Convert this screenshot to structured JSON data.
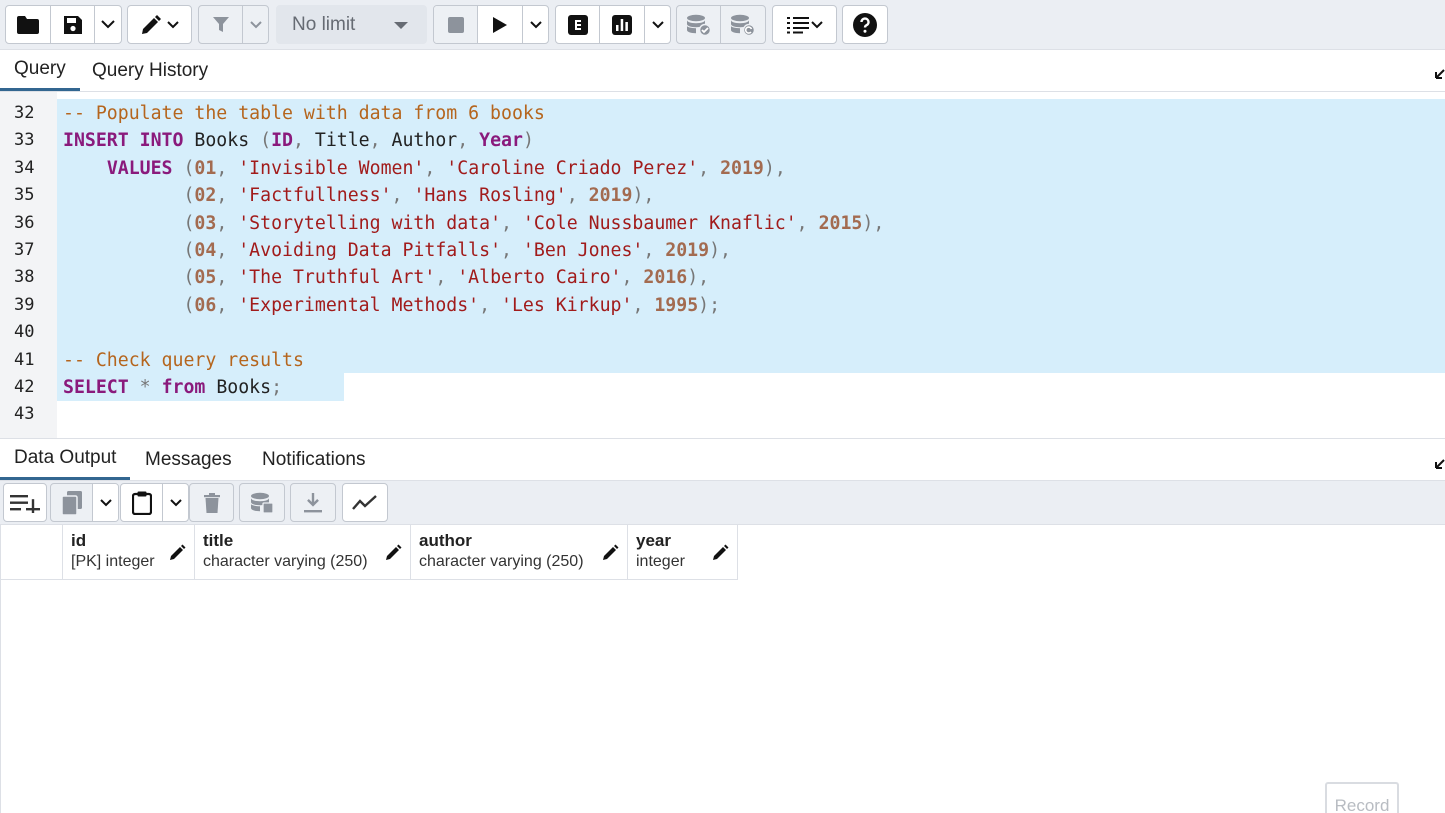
{
  "toolbar": {
    "row_limit": "No limit"
  },
  "query_tabs": [
    {
      "label": "Query",
      "active": true
    },
    {
      "label": "Query History",
      "active": false
    }
  ],
  "editor": {
    "lines": [
      {
        "num": "32",
        "tokens": [
          {
            "t": "cmt",
            "v": "-- Populate the table with data from 6 books"
          }
        ]
      },
      {
        "num": "33",
        "tokens": [
          {
            "t": "kw",
            "v": "INSERT INTO"
          },
          {
            "t": "",
            "v": " Books "
          },
          {
            "t": "pun",
            "v": "("
          },
          {
            "t": "kw",
            "v": "ID"
          },
          {
            "t": "pun",
            "v": ","
          },
          {
            "t": "",
            "v": " Title"
          },
          {
            "t": "pun",
            "v": ","
          },
          {
            "t": "",
            "v": " Author"
          },
          {
            "t": "pun",
            "v": ","
          },
          {
            "t": "",
            "v": " "
          },
          {
            "t": "kw",
            "v": "Year"
          },
          {
            "t": "pun",
            "v": ")"
          }
        ]
      },
      {
        "num": "34",
        "tokens": [
          {
            "t": "",
            "v": "    "
          },
          {
            "t": "kw",
            "v": "VALUES"
          },
          {
            "t": "",
            "v": " "
          },
          {
            "t": "pun",
            "v": "("
          },
          {
            "t": "num",
            "v": "01"
          },
          {
            "t": "pun",
            "v": ","
          },
          {
            "t": "",
            "v": " "
          },
          {
            "t": "str",
            "v": "'Invisible Women'"
          },
          {
            "t": "pun",
            "v": ","
          },
          {
            "t": "",
            "v": " "
          },
          {
            "t": "str",
            "v": "'Caroline Criado Perez'"
          },
          {
            "t": "pun",
            "v": ","
          },
          {
            "t": "",
            "v": " "
          },
          {
            "t": "num",
            "v": "2019"
          },
          {
            "t": "pun",
            "v": "),"
          }
        ]
      },
      {
        "num": "35",
        "tokens": [
          {
            "t": "",
            "v": "           "
          },
          {
            "t": "pun",
            "v": "("
          },
          {
            "t": "num",
            "v": "02"
          },
          {
            "t": "pun",
            "v": ","
          },
          {
            "t": "",
            "v": " "
          },
          {
            "t": "str",
            "v": "'Factfullness'"
          },
          {
            "t": "pun",
            "v": ","
          },
          {
            "t": "",
            "v": " "
          },
          {
            "t": "str",
            "v": "'Hans Rosling'"
          },
          {
            "t": "pun",
            "v": ","
          },
          {
            "t": "",
            "v": " "
          },
          {
            "t": "num",
            "v": "2019"
          },
          {
            "t": "pun",
            "v": "),"
          }
        ]
      },
      {
        "num": "36",
        "tokens": [
          {
            "t": "",
            "v": "           "
          },
          {
            "t": "pun",
            "v": "("
          },
          {
            "t": "num",
            "v": "03"
          },
          {
            "t": "pun",
            "v": ","
          },
          {
            "t": "",
            "v": " "
          },
          {
            "t": "str",
            "v": "'Storytelling with data'"
          },
          {
            "t": "pun",
            "v": ","
          },
          {
            "t": "",
            "v": " "
          },
          {
            "t": "str",
            "v": "'Cole Nussbaumer Knaflic'"
          },
          {
            "t": "pun",
            "v": ","
          },
          {
            "t": "",
            "v": " "
          },
          {
            "t": "num",
            "v": "2015"
          },
          {
            "t": "pun",
            "v": "),"
          }
        ]
      },
      {
        "num": "37",
        "tokens": [
          {
            "t": "",
            "v": "           "
          },
          {
            "t": "pun",
            "v": "("
          },
          {
            "t": "num",
            "v": "04"
          },
          {
            "t": "pun",
            "v": ","
          },
          {
            "t": "",
            "v": " "
          },
          {
            "t": "str",
            "v": "'Avoiding Data Pitfalls'"
          },
          {
            "t": "pun",
            "v": ","
          },
          {
            "t": "",
            "v": " "
          },
          {
            "t": "str",
            "v": "'Ben Jones'"
          },
          {
            "t": "pun",
            "v": ","
          },
          {
            "t": "",
            "v": " "
          },
          {
            "t": "num",
            "v": "2019"
          },
          {
            "t": "pun",
            "v": "),"
          }
        ]
      },
      {
        "num": "38",
        "tokens": [
          {
            "t": "",
            "v": "           "
          },
          {
            "t": "pun",
            "v": "("
          },
          {
            "t": "num",
            "v": "05"
          },
          {
            "t": "pun",
            "v": ","
          },
          {
            "t": "",
            "v": " "
          },
          {
            "t": "str",
            "v": "'The Truthful Art'"
          },
          {
            "t": "pun",
            "v": ","
          },
          {
            "t": "",
            "v": " "
          },
          {
            "t": "str",
            "v": "'Alberto Cairo'"
          },
          {
            "t": "pun",
            "v": ","
          },
          {
            "t": "",
            "v": " "
          },
          {
            "t": "num",
            "v": "2016"
          },
          {
            "t": "pun",
            "v": "),"
          }
        ]
      },
      {
        "num": "39",
        "tokens": [
          {
            "t": "",
            "v": "           "
          },
          {
            "t": "pun",
            "v": "("
          },
          {
            "t": "num",
            "v": "06"
          },
          {
            "t": "pun",
            "v": ","
          },
          {
            "t": "",
            "v": " "
          },
          {
            "t": "str",
            "v": "'Experimental Methods'"
          },
          {
            "t": "pun",
            "v": ","
          },
          {
            "t": "",
            "v": " "
          },
          {
            "t": "str",
            "v": "'Les Kirkup'"
          },
          {
            "t": "pun",
            "v": ","
          },
          {
            "t": "",
            "v": " "
          },
          {
            "t": "num",
            "v": "1995"
          },
          {
            "t": "pun",
            "v": ");"
          }
        ]
      },
      {
        "num": "40",
        "tokens": []
      },
      {
        "num": "41",
        "tokens": [
          {
            "t": "cmt",
            "v": "-- Check query results"
          }
        ]
      },
      {
        "num": "42",
        "tokens": [
          {
            "t": "kw",
            "v": "SELECT"
          },
          {
            "t": "",
            "v": " "
          },
          {
            "t": "pun",
            "v": "*"
          },
          {
            "t": "",
            "v": " "
          },
          {
            "t": "kw",
            "v": "from"
          },
          {
            "t": "",
            "v": " Books"
          },
          {
            "t": "pun",
            "v": ";"
          }
        ]
      },
      {
        "num": "43",
        "tokens": []
      }
    ]
  },
  "output_tabs": [
    {
      "label": "Data Output",
      "active": true
    },
    {
      "label": "Messages",
      "active": false
    },
    {
      "label": "Notifications",
      "active": false
    }
  ],
  "columns": [
    {
      "name": "id",
      "type": "[PK] integer"
    },
    {
      "name": "title",
      "type": "character varying (250)"
    },
    {
      "name": "author",
      "type": "character varying (250)"
    },
    {
      "name": "year",
      "type": "integer"
    }
  ],
  "record_label": "Record",
  "colors": {
    "keyword": "#8a1a7c",
    "string": "#a11b1b",
    "number": "#a36b50",
    "comment": "#b5651d",
    "selection": "#d6eefb",
    "active_tab": "#326690"
  }
}
